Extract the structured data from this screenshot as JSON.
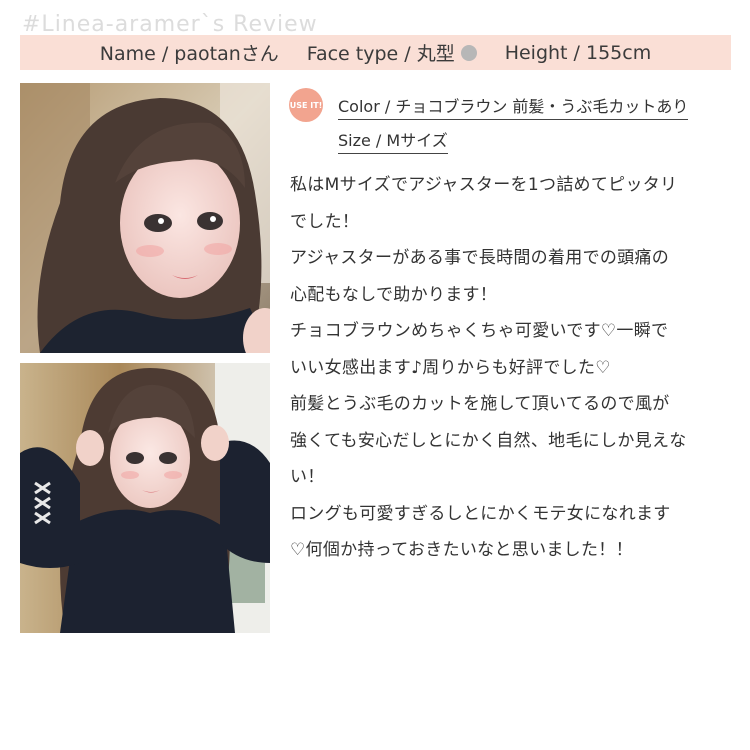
{
  "watermark": "#Linea-aramer`s Review",
  "info": {
    "name": "Name / paotanさん",
    "face_type": "Face type / 丸型",
    "height": "Height / 155cm"
  },
  "badge": "USE IT!",
  "spec": {
    "color": "Color / チョコブラウン 前髪・うぶ毛カットあり",
    "size": "Size / Mサイズ"
  },
  "review_lines": [
    "私はMサイズでアジャスターを1つ詰めてピッタリ",
    "でした！",
    "アジャスターがある事で長時間の着用での頭痛の",
    "心配もなしで助かります！",
    "チョコブラウンめちゃくちゃ可愛いです♡一瞬で",
    "いい女感出ます♪周りからも好評でした♡",
    "前髪とうぶ毛のカットを施して頂いてるので風が",
    "強くても安心だしとにかく自然、地毛にしか見えな",
    "い！",
    "ロングも可愛すぎるしとにかくモテ女になれます",
    "♡何個か持っておきたいなと思いました！！"
  ],
  "colors": {
    "info_bar": "#fadfd6",
    "badge": "#f2a48f",
    "face_dot": "#b7b7b7"
  }
}
